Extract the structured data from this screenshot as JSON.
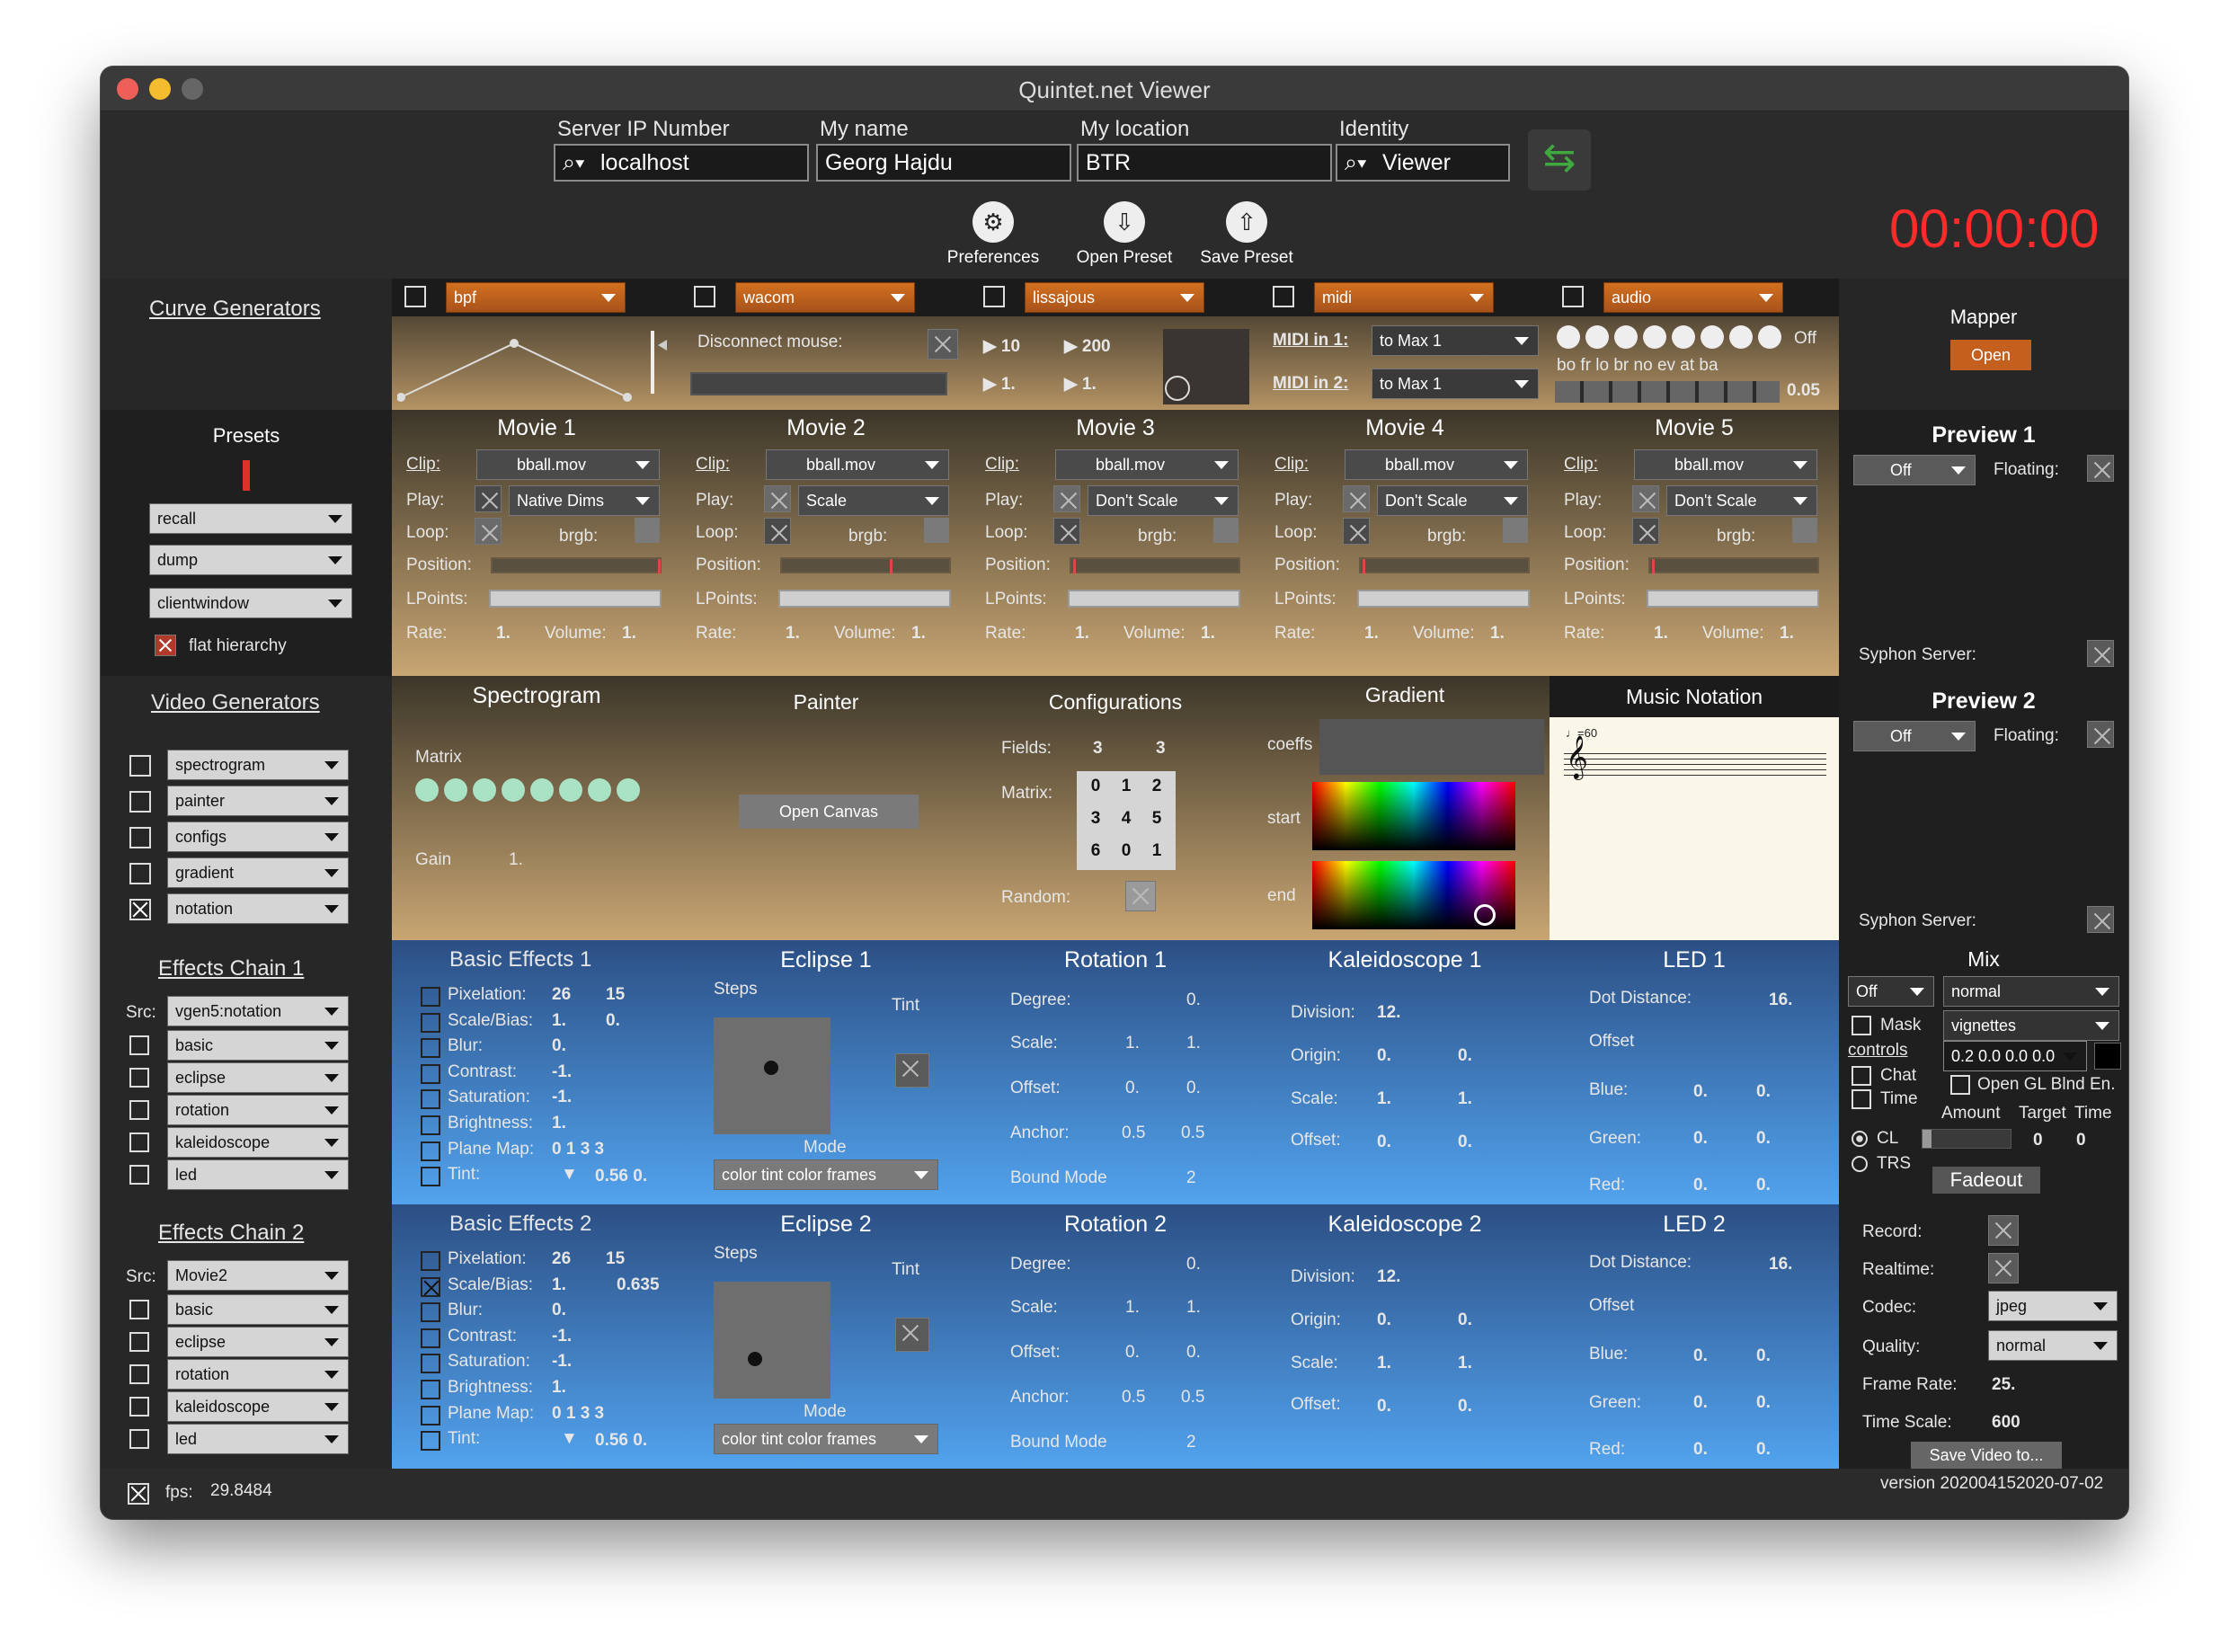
{
  "window": {
    "title": "Quintet.net Viewer"
  },
  "top": {
    "server_label": "Server IP Number",
    "server_value": "localhost",
    "name_label": "My name",
    "name_value": "Georg Hajdu",
    "location_label": "My location",
    "location_value": "BTR",
    "identity_label": "Identity",
    "identity_value": "Viewer",
    "preferences": "Preferences",
    "open_preset": "Open Preset",
    "save_preset": "Save Preset",
    "timer": "00:00:00"
  },
  "curve": {
    "title": "Curve Generators",
    "g1": {
      "select": "bpf"
    },
    "g2": {
      "select": "wacom",
      "disconnect": "Disconnect mouse:"
    },
    "g3": {
      "select": "lissajous",
      "a": "10",
      "b": "200",
      "c": "1.",
      "d": "1."
    },
    "g4": {
      "select": "midi",
      "in1": "MIDI in 1:",
      "in1v": "to Max 1",
      "in2": "MIDI in 2:",
      "in2v": "to Max 1"
    },
    "g5": {
      "select": "audio",
      "off": "Off",
      "labels": "bo fr  lo  br no ev at  ba",
      "value": "0.05"
    },
    "mapper": "Mapper",
    "mapper_btn": "Open"
  },
  "presets": {
    "title": "Presets",
    "items": [
      "recall",
      "dump",
      "clientwindow"
    ],
    "flat": "flat hierarchy"
  },
  "movies": [
    {
      "title": "Movie 1",
      "clip": "bball.mov",
      "play": "Native Dims",
      "rate": "1.",
      "volume": "1."
    },
    {
      "title": "Movie 2",
      "clip": "bball.mov",
      "play": "Scale",
      "rate": "1.",
      "volume": "1."
    },
    {
      "title": "Movie 3",
      "clip": "bball.mov",
      "play": "Don't Scale",
      "rate": "1.",
      "volume": "1."
    },
    {
      "title": "Movie 4",
      "clip": "bball.mov",
      "play": "Don't Scale",
      "rate": "1.",
      "volume": "1."
    },
    {
      "title": "Movie 5",
      "clip": "bball.mov",
      "play": "Don't Scale",
      "rate": "1.",
      "volume": "1."
    }
  ],
  "movie_labels": {
    "clip": "Clip:",
    "play": "Play:",
    "loop": "Loop:",
    "brgb": "brgb:",
    "position": "Position:",
    "lpoints": "LPoints:",
    "rate": "Rate:",
    "volume": "Volume:"
  },
  "preview1": {
    "title": "Preview 1",
    "mode": "Off",
    "floating": "Floating:",
    "syphon": "Syphon Server:"
  },
  "preview2": {
    "title": "Preview 2",
    "mode": "Off",
    "floating": "Floating:",
    "syphon": "Syphon Server:"
  },
  "videogen": {
    "title": "Video Generators",
    "items": [
      "spectrogram",
      "painter",
      "configs",
      "gradient",
      "notation"
    ]
  },
  "spectrogram": {
    "title": "Spectrogram",
    "matrix": "Matrix",
    "gain": "Gain",
    "gain_v": "1."
  },
  "painter": {
    "title": "Painter",
    "btn": "Open Canvas"
  },
  "configs": {
    "title": "Configurations",
    "fields": "Fields:",
    "f1": "3",
    "f2": "3",
    "matrix": "Matrix:",
    "m": [
      "0",
      "1",
      "2",
      "3",
      "4",
      "5",
      "6",
      "0",
      "1"
    ],
    "random": "Random:"
  },
  "gradient": {
    "title": "Gradient",
    "coeffs": "coeffs",
    "start": "start",
    "end": "end"
  },
  "notation": {
    "title": "Music Notation",
    "tempo": "♩=60"
  },
  "chain1": {
    "title": "Effects Chain 1",
    "src": "Src:",
    "src_v": "vgen5:notation",
    "items": [
      "basic",
      "eclipse",
      "rotation",
      "kaleidoscope",
      "led"
    ]
  },
  "chain2": {
    "title": "Effects Chain 2",
    "src": "Src:",
    "src_v": "Movie2",
    "items": [
      "basic",
      "eclipse",
      "rotation",
      "kaleidoscope",
      "led"
    ]
  },
  "basic1": {
    "title": "Basic Effects 1",
    "pix": "Pixelation:",
    "pix1": "26",
    "pix2": "15",
    "sb": "Scale/Bias:",
    "sb1": "1.",
    "sb2": "0.",
    "blur": "Blur:",
    "blur_v": "0.",
    "con": "Contrast:",
    "con_v": "-1.",
    "sat": "Saturation:",
    "sat_v": "-1.",
    "bri": "Brightness:",
    "bri_v": "1.",
    "pm": "Plane Map:",
    "pm_v": "0  1  3  3",
    "tint": "Tint:",
    "tint_v": "0.56 0."
  },
  "basic2": {
    "title": "Basic Effects 2",
    "pix": "Pixelation:",
    "pix1": "26",
    "pix2": "15",
    "sb": "Scale/Bias:",
    "sb1": "1.",
    "sb2": "0.635",
    "blur": "Blur:",
    "blur_v": "0.",
    "con": "Contrast:",
    "con_v": "-1.",
    "sat": "Saturation:",
    "sat_v": "-1.",
    "bri": "Brightness:",
    "bri_v": "1.",
    "pm": "Plane Map:",
    "pm_v": "0  1  3  3",
    "tint": "Tint:",
    "tint_v": "0.56 0."
  },
  "eclipse1": {
    "title": "Eclipse 1",
    "steps": "Steps",
    "tint": "Tint",
    "mode": "Mode",
    "mode_v": "color tint color frames"
  },
  "eclipse2": {
    "title": "Eclipse 2",
    "steps": "Steps",
    "tint": "Tint",
    "mode": "Mode",
    "mode_v": "color tint color frames"
  },
  "rot1": {
    "title": "Rotation 1",
    "deg": "Degree:",
    "deg_v": "0.",
    "scale": "Scale:",
    "s1": "1.",
    "s2": "1.",
    "off": "Offset:",
    "o1": "0.",
    "o2": "0.",
    "anc": "Anchor:",
    "a1": "0.5",
    "a2": "0.5",
    "bm": "Bound Mode",
    "bm_v": "2"
  },
  "rot2": {
    "title": "Rotation 2",
    "deg": "Degree:",
    "deg_v": "0.",
    "scale": "Scale:",
    "s1": "1.",
    "s2": "1.",
    "off": "Offset:",
    "o1": "0.",
    "o2": "0.",
    "anc": "Anchor:",
    "a1": "0.5",
    "a2": "0.5",
    "bm": "Bound Mode",
    "bm_v": "2"
  },
  "kal1": {
    "title": "Kaleidoscope 1",
    "div": "Division:",
    "div_v": "12.",
    "ori": "Origin:",
    "or1": "0.",
    "or2": "0.",
    "sc": "Scale:",
    "sc1": "1.",
    "sc2": "1.",
    "off": "Offset:",
    "of1": "0.",
    "of2": "0."
  },
  "kal2": {
    "title": "Kaleidoscope 2",
    "div": "Division:",
    "div_v": "12.",
    "ori": "Origin:",
    "or1": "0.",
    "or2": "0.",
    "sc": "Scale:",
    "sc1": "1.",
    "sc2": "1.",
    "off": "Offset:",
    "of1": "0.",
    "of2": "0."
  },
  "led1": {
    "title": "LED 1",
    "dd": "Dot Distance:",
    "dd_v": "16.",
    "offset": "Offset",
    "blue": "Blue:",
    "green": "Green:",
    "red": "Red:",
    "z": "0."
  },
  "led2": {
    "title": "LED 2",
    "dd": "Dot Distance:",
    "dd_v": "16.",
    "offset": "Offset",
    "blue": "Blue:",
    "green": "Green:",
    "red": "Red:",
    "z": "0."
  },
  "mix": {
    "title": "Mix",
    "off": "Off",
    "blend": "normal",
    "mask": "Mask",
    "vignettes": "vignettes",
    "controls": "controls",
    "vals": "0.2 0.0 0.0 0.0",
    "chat": "Chat",
    "time": "Time",
    "opengl": "Open GL Blnd En.",
    "amount": "Amount",
    "target": "Target",
    "timel": "Time",
    "cl": "CL",
    "trs": "TRS",
    "t0": "0",
    "t1": "0",
    "fadeout": "Fadeout"
  },
  "record": {
    "record": "Record:",
    "realtime": "Realtime:",
    "codec": "Codec:",
    "codec_v": "jpeg",
    "quality": "Quality:",
    "quality_v": "normal",
    "fr": "Frame Rate:",
    "fr_v": "25.",
    "ts": "Time Scale:",
    "ts_v": "600",
    "save": "Save Video to..."
  },
  "status": {
    "fps": "fps:",
    "fps_v": "29.8484",
    "version": "version 202004152020-07-02"
  }
}
